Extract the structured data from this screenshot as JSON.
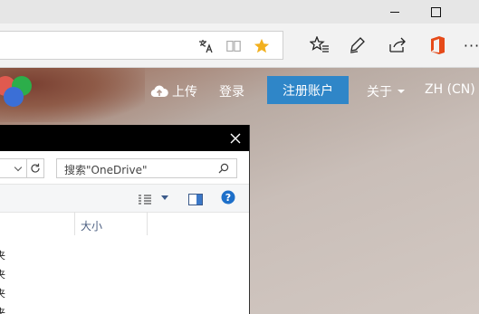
{
  "browser": {
    "window_controls": {
      "minimize": "—",
      "maximize": "☐"
    },
    "toolbar": {
      "more_label": "···"
    }
  },
  "site": {
    "nav": {
      "upload": "上传",
      "login": "登录",
      "register": "注册账户",
      "about": "关于",
      "language": "ZH (CN)"
    },
    "accent_color": "#2f86c8"
  },
  "explorer": {
    "search_placeholder": "搜索\"OneDrive\"",
    "columns": {
      "size": "大小"
    },
    "rows": [
      "夹",
      "夹",
      "夹",
      "夹"
    ]
  }
}
